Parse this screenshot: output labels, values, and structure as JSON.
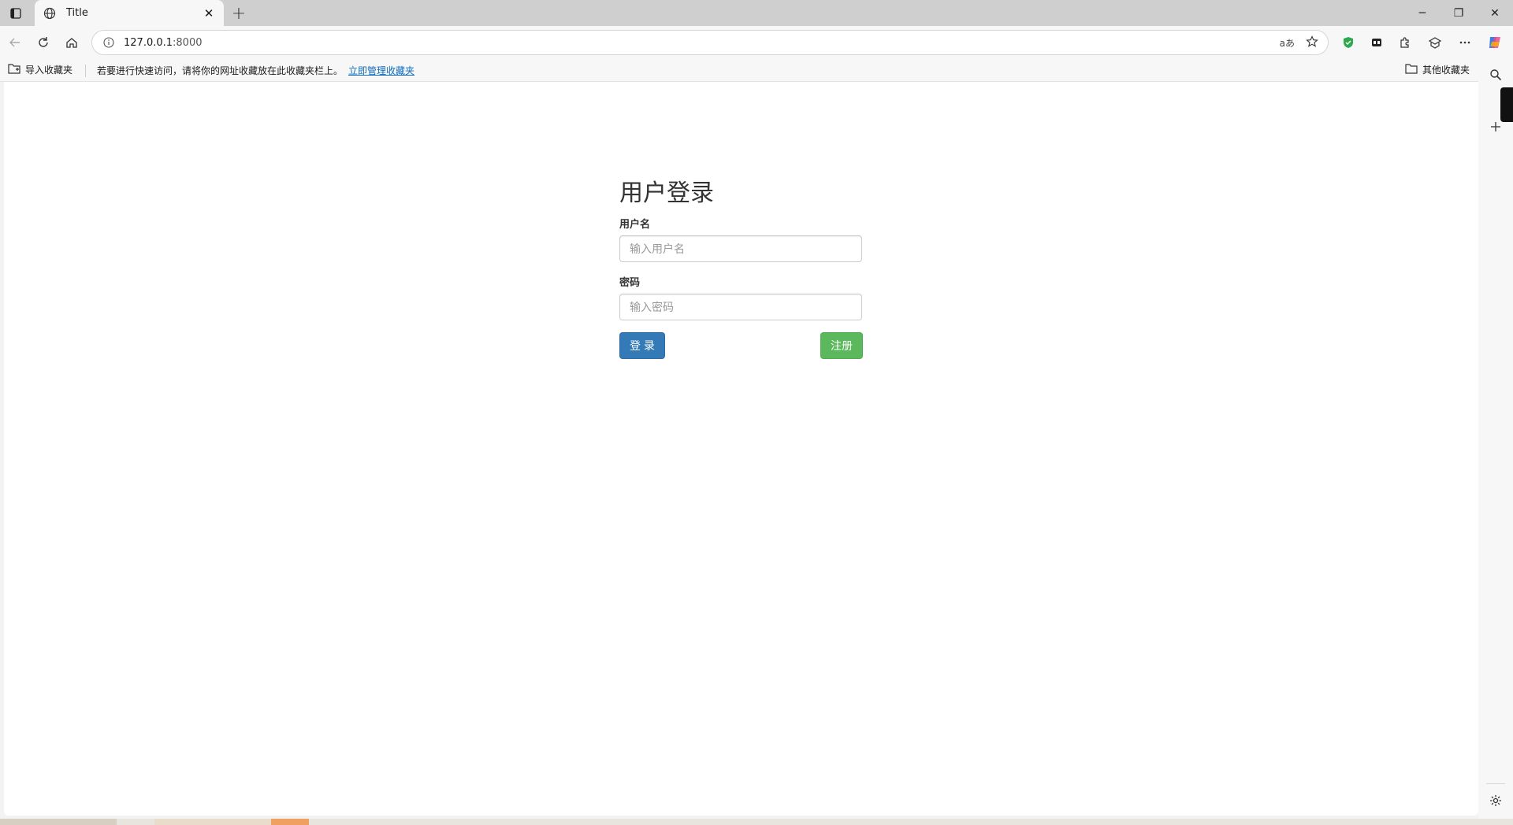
{
  "tab": {
    "title": "Title"
  },
  "address": {
    "host": "127.0.0.1",
    "port": ":8000"
  },
  "omnibox": {
    "read_aloud": "aあ"
  },
  "bookmarks": {
    "import": "导入收藏夹",
    "tip": "若要进行快速访问，请将你的网址收藏放在此收藏夹栏上。",
    "manage_link": "立即管理收藏夹",
    "other": "其他收藏夹"
  },
  "login": {
    "heading": "用户登录",
    "username_label": "用户名",
    "username_placeholder": "输入用户名",
    "password_label": "密码",
    "password_placeholder": "输入密码",
    "login_button": "登 录",
    "register_button": "注册"
  },
  "icons": {
    "tab_actions": "tab-actions-icon",
    "favicon": "globe-icon",
    "close": "close-icon",
    "new_tab": "plus-icon",
    "back": "back-arrow-icon",
    "refresh": "refresh-icon",
    "home": "home-icon",
    "info": "info-icon",
    "favorite": "star-icon",
    "settings": "gear-icon",
    "search": "search-icon"
  },
  "colors": {
    "primary": "#337ab7",
    "success": "#5cb85c",
    "link": "#0f6cbd"
  }
}
